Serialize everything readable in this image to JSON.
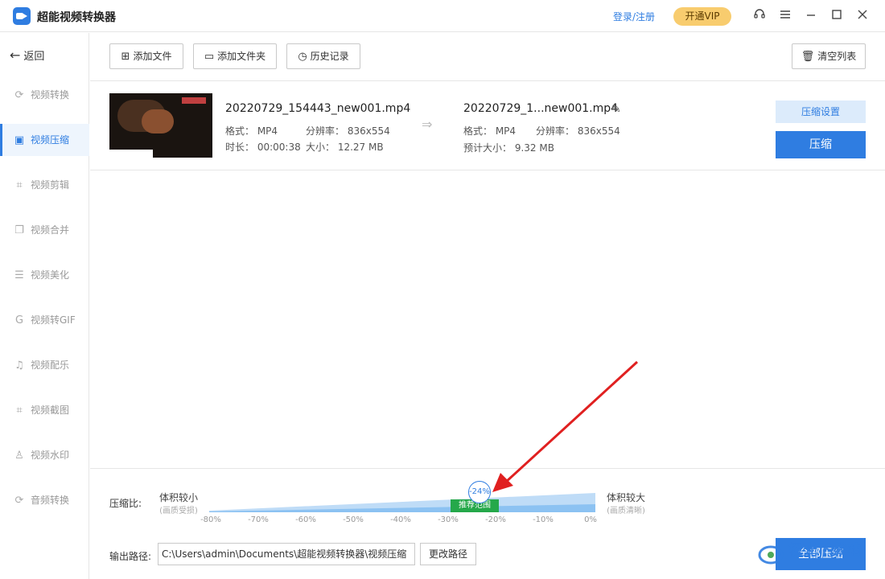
{
  "app": {
    "title": "超能视频转换器",
    "login": "登录/注册",
    "vip": "开通VIP"
  },
  "sidebar": {
    "back": "返回",
    "items": [
      {
        "label": "视频转换",
        "icon": "refresh-icon"
      },
      {
        "label": "视频压缩",
        "icon": "compress-icon",
        "active": true
      },
      {
        "label": "视频剪辑",
        "icon": "crop-icon"
      },
      {
        "label": "视频合并",
        "icon": "merge-icon"
      },
      {
        "label": "视频美化",
        "icon": "sliders-icon"
      },
      {
        "label": "视频转GIF",
        "icon": "gif-icon"
      },
      {
        "label": "视频配乐",
        "icon": "music-icon"
      },
      {
        "label": "视频截图",
        "icon": "screenshot-icon"
      },
      {
        "label": "视频水印",
        "icon": "watermark-icon"
      },
      {
        "label": "音频转换",
        "icon": "audio-refresh-icon"
      }
    ]
  },
  "toolbar": {
    "add_file": "添加文件",
    "add_folder": "添加文件夹",
    "history": "历史记录",
    "clear": "清空列表"
  },
  "file": {
    "source_name": "20220729_154443_new001.mp4",
    "source_format": "格式： MP4",
    "source_resolution": "分辨率： 836x554",
    "source_duration": "时长： 00:00:38",
    "source_size": "大小： 12.27 MB",
    "target_name": "20220729_1...new001.mp4",
    "target_format": "格式： MP4",
    "target_resolution": "分辨率： 836x554",
    "target_size": "预计大小： 9.32 MB",
    "settings_btn": "压缩设置",
    "compress_btn": "压缩"
  },
  "compression": {
    "label": "压缩比:",
    "left_label": "体积较小",
    "left_sub": "(画质受损)",
    "right_label": "体积较大",
    "right_sub": "(画质清晰)",
    "recommended": "推荐范围",
    "value": "-24%",
    "ticks": [
      "-80%",
      "-70%",
      "-60%",
      "-50%",
      "-40%",
      "-30%",
      "-20%",
      "-10%",
      "0%"
    ]
  },
  "output": {
    "label": "输出路径:",
    "path": "C:\\Users\\admin\\Documents\\超能视频转换器\\视频压缩",
    "change_btn": "更改路径",
    "all_btn": "全部压缩"
  },
  "watermark": {
    "text": "极光下载站"
  },
  "colors": {
    "accent": "#2f7de1",
    "vip": "#f8cc6e",
    "recommend": "#25a84a",
    "annotation": "#e02020"
  }
}
